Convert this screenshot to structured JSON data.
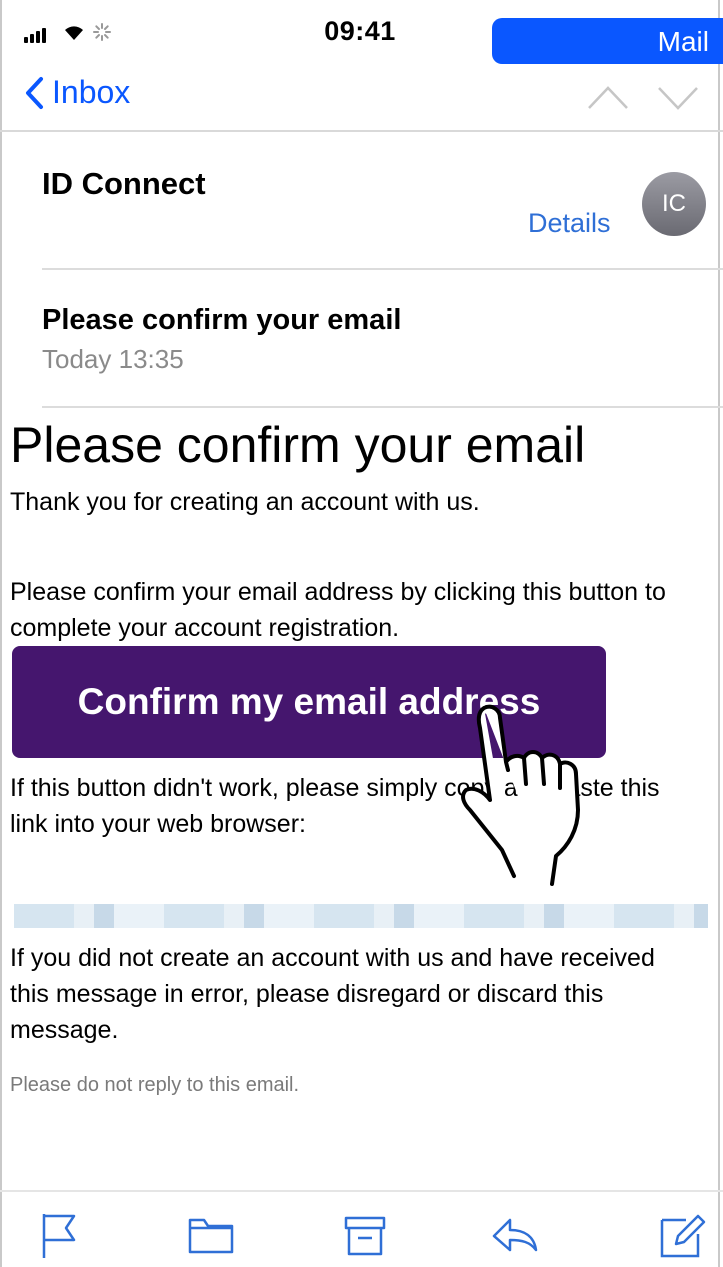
{
  "status_bar": {
    "time": "09:41",
    "app_indicator": "Mail"
  },
  "nav": {
    "back_label": "Inbox",
    "icons": [
      "chevron-left-icon",
      "chevron-up-icon",
      "chevron-down-icon"
    ]
  },
  "header": {
    "sender": "ID Connect",
    "details_label": "Details",
    "avatar_initials": "IC",
    "subject": "Please confirm your email",
    "date": "Today 13:35"
  },
  "email_body": {
    "title": "Please confirm your email",
    "intro": "Thank you for creating an account with us.",
    "instruction": "Please confirm your email address by clicking this button to\ncomplete your account registration.",
    "button_label": "Confirm my email address",
    "fallback": "If this button didn't work, please simply copy and paste this\nlink into your web browser:",
    "disclaimer": "If you did not create an account with us and have received\nthis message in error, please disregard or discard this\nmessage.",
    "no_reply": "Please do not reply to this email."
  },
  "toolbar": {
    "icons": [
      "flag-icon",
      "folder-icon",
      "archive-icon",
      "reply-icon",
      "compose-icon"
    ]
  },
  "colors": {
    "accent": "#0a57ff",
    "button": "#45166e",
    "details": "#2f6fd6"
  }
}
